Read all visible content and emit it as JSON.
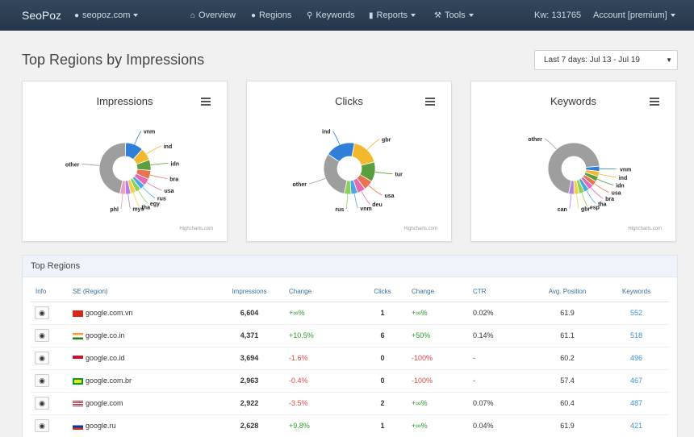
{
  "nav": {
    "brand": "SeoPoz",
    "site": "seopoz.com",
    "overview": "Overview",
    "regions": "Regions",
    "keywords": "Keywords",
    "reports": "Reports",
    "tools": "Tools",
    "kw": "Kw: 131765",
    "account": "Account [premium]"
  },
  "page": {
    "title": "Top Regions by Impressions",
    "date_range": "Last 7 days: Jul 13 - Jul 19"
  },
  "chart_data": [
    {
      "type": "pie",
      "title": "Impressions",
      "credit": "Highcharts.com",
      "categories": [
        "other",
        "vnm",
        "ind",
        "idn",
        "bra",
        "usa",
        "rus",
        "egy",
        "tha",
        "mys",
        "phl"
      ],
      "values": [
        42,
        10,
        7,
        6,
        5,
        4,
        3,
        3,
        3,
        3,
        3
      ],
      "colors": [
        "#9e9e9e",
        "#2f7ed8",
        "#f2b830",
        "#5a9e3d",
        "#e8744f",
        "#e26cb0",
        "#49a8e0",
        "#8bd05a",
        "#f0d24a",
        "#b57ee0",
        "#e9a0c0"
      ]
    },
    {
      "type": "pie",
      "title": "Clicks",
      "credit": "Highcharts.com",
      "categories": [
        "other",
        "ind",
        "gbr",
        "tur",
        "usa",
        "deu",
        "vnm",
        "rus"
      ],
      "values": [
        30,
        18,
        17,
        12,
        6,
        5,
        4,
        4
      ],
      "colors": [
        "#9e9e9e",
        "#2f7ed8",
        "#f2b830",
        "#5a9e3d",
        "#e8744f",
        "#e26cb0",
        "#49a8e0",
        "#8bd05a"
      ]
    },
    {
      "type": "pie",
      "title": "Keywords",
      "credit": "Highcharts.com",
      "categories": [
        "other",
        "vnm",
        "ind",
        "idn",
        "usa",
        "bra",
        "tha",
        "esp",
        "gbr",
        "can"
      ],
      "values": [
        64,
        3,
        3,
        3,
        3,
        3,
        3,
        3,
        3,
        3
      ],
      "colors": [
        "#9e9e9e",
        "#2f7ed8",
        "#f2b830",
        "#5a9e3d",
        "#e8744f",
        "#e26cb0",
        "#49a8e0",
        "#8bd05a",
        "#f0d24a",
        "#b57ee0"
      ]
    }
  ],
  "table": {
    "panel_title": "Top Regions",
    "headers": {
      "info": "Info",
      "se": "SE (Region)",
      "impressions": "Impressions",
      "change1": "Change",
      "clicks": "Clicks",
      "change2": "Change",
      "ctr": "CTR",
      "avgpos": "Avg. Position",
      "keywords": "Keywords"
    },
    "rows": [
      {
        "se": "google.com.vn",
        "flag": "vn",
        "impressions": "6,604",
        "change": "+∞%",
        "change_class": "pos",
        "clicks": "1",
        "clicks_change": "+∞%",
        "clicks_change_class": "pos",
        "ctr": "0.02%",
        "avgpos": "61.9",
        "keywords": "552"
      },
      {
        "se": "google.co.in",
        "flag": "in",
        "impressions": "4,371",
        "change": "+10.5%",
        "change_class": "pos",
        "clicks": "6",
        "clicks_change": "+50%",
        "clicks_change_class": "pos",
        "ctr": "0.14%",
        "avgpos": "61.1",
        "keywords": "518"
      },
      {
        "se": "google.co.id",
        "flag": "id",
        "impressions": "3,694",
        "change": "-1.6%",
        "change_class": "neg",
        "clicks": "0",
        "clicks_change": "-100%",
        "clicks_change_class": "neg",
        "ctr": "-",
        "avgpos": "60.2",
        "keywords": "496"
      },
      {
        "se": "google.com.br",
        "flag": "br",
        "impressions": "2,963",
        "change": "-0.4%",
        "change_class": "neg",
        "clicks": "0",
        "clicks_change": "-100%",
        "clicks_change_class": "neg",
        "ctr": "-",
        "avgpos": "57.4",
        "keywords": "467"
      },
      {
        "se": "google.com",
        "flag": "us",
        "impressions": "2,922",
        "change": "-3.5%",
        "change_class": "neg",
        "clicks": "2",
        "clicks_change": "+∞%",
        "clicks_change_class": "pos",
        "ctr": "0.07%",
        "avgpos": "60.4",
        "keywords": "487"
      },
      {
        "se": "google.ru",
        "flag": "ru",
        "impressions": "2,628",
        "change": "+9.8%",
        "change_class": "pos",
        "clicks": "1",
        "clicks_change": "+∞%",
        "clicks_change_class": "pos",
        "ctr": "0.04%",
        "avgpos": "61.9",
        "keywords": "421"
      }
    ]
  }
}
